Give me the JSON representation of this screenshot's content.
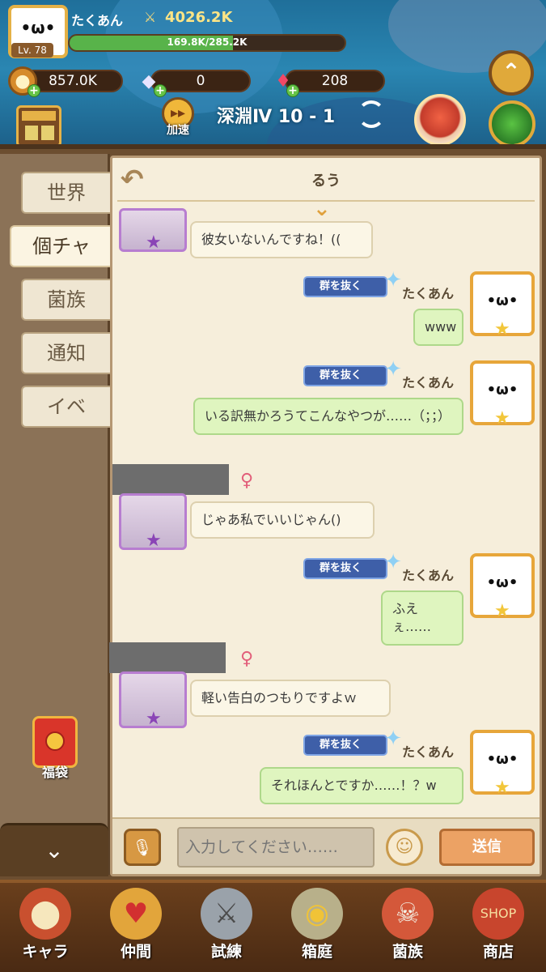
{
  "player": {
    "level": "Lv. 78",
    "name": "たくあん",
    "power": "4026.2K",
    "exp_text": "169.8K/285.2K",
    "exp_fraction": 0.595,
    "avatar_face": "•ω•"
  },
  "currencies": [
    {
      "icon": "coin-icon",
      "value": "857.0K"
    },
    {
      "icon": "diamond-icon",
      "value": "0"
    },
    {
      "icon": "ruby-icon",
      "value": "208"
    }
  ],
  "hud": {
    "speed_label": "加速",
    "stage": "深淵Ⅳ 10 - 1"
  },
  "side_tabs": [
    {
      "label": "世界",
      "active": false
    },
    {
      "label": "個チャ",
      "active": true
    },
    {
      "label": "菌族",
      "active": false
    },
    {
      "label": "通知",
      "active": false
    },
    {
      "label": "イベ",
      "active": false
    }
  ],
  "lucky_bag_label": "福袋",
  "chat": {
    "title": "るう",
    "leave_badge": "群を抜く",
    "messages": [
      {
        "dir": "in",
        "text": "彼女いないんですね！(("
      },
      {
        "dir": "out",
        "name": "たくあん",
        "text": "www"
      },
      {
        "dir": "out",
        "name": "たくあん",
        "text": "いる訳無かろうてこんなやつが……（；；）"
      },
      {
        "dir": "in",
        "text": "じゃあ私でいいじゃん()"
      },
      {
        "dir": "out",
        "name": "たくあん",
        "text": "ふえぇ……"
      },
      {
        "dir": "in",
        "text": "軽い告白のつもりですよｗ"
      },
      {
        "dir": "out",
        "name": "たくあん",
        "text": "それほんとですか……！？w"
      }
    ]
  },
  "input": {
    "placeholder": "入力してください……",
    "send_label": "送信"
  },
  "nav": [
    {
      "label": "キャラ",
      "icon": "mushroom-icon"
    },
    {
      "label": "仲間",
      "icon": "paw-icon"
    },
    {
      "label": "試練",
      "icon": "crossed-swords-icon"
    },
    {
      "label": "箱庭",
      "icon": "garden-icon"
    },
    {
      "label": "菌族",
      "icon": "skull-banner-icon"
    },
    {
      "label": "商店",
      "icon": "shop-icon"
    }
  ],
  "colors": {
    "gold": "#e7a63a",
    "bubble_in": "#fbf6e6",
    "bubble_out": "#dff5bf",
    "send_button": "#eca264"
  }
}
